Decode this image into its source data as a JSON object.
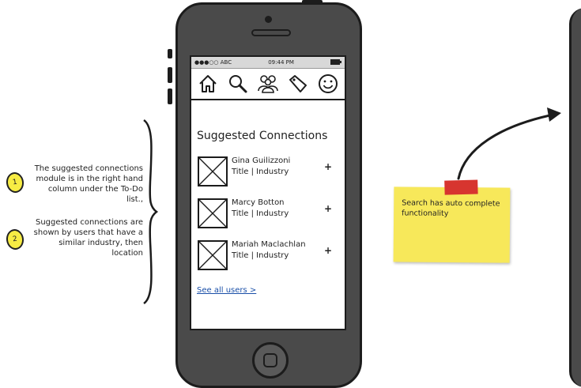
{
  "annotations": [
    {
      "number": "1",
      "text": "The suggested connections module is in the right hand column under the To-Do list.,"
    },
    {
      "number": "2",
      "text": "Suggested connections are shown by users that have a similar industry, then location"
    }
  ],
  "status_bar": {
    "carrier": "●●●○○ ABC",
    "time": "09:44 PM"
  },
  "nav_icons": [
    "home-icon",
    "search-icon",
    "people-icon",
    "tag-icon",
    "smiley-icon"
  ],
  "suggested": {
    "title": "Suggested Connections",
    "items": [
      {
        "name": "Gina Guilizzoni",
        "subtitle": "Title | Industry",
        "action": "+"
      },
      {
        "name": "Marcy Botton",
        "subtitle": "Title | Industry",
        "action": "+"
      },
      {
        "name": "Mariah Maclachlan",
        "subtitle": "Title | Industry",
        "action": "+"
      }
    ],
    "see_all": "See all users >"
  },
  "sticky_note": {
    "text": "Search has auto complete functionality"
  },
  "colors": {
    "phone_body": "#4a4a4a",
    "sticky": "#f7e85a",
    "tape": "#d7352f",
    "link": "#1a4fa8",
    "badge": "#f7ec44"
  }
}
